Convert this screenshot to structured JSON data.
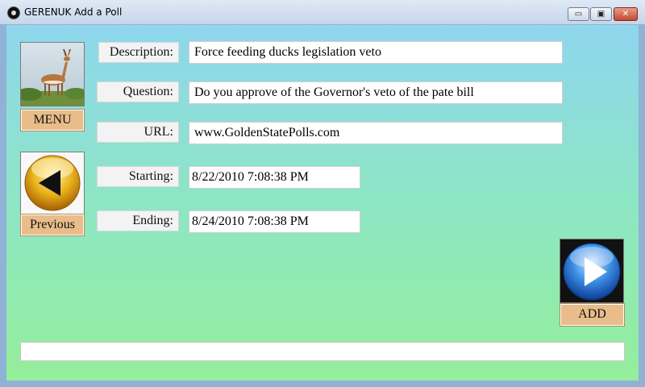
{
  "window": {
    "title": "GERENUK Add a Poll",
    "minimize_glyph": "▭",
    "maximize_glyph": "▣",
    "close_glyph": "✕"
  },
  "sidebar": {
    "menu_label": "MENU",
    "previous_label": "Previous",
    "menu_image": "gerenuk-photo",
    "previous_icon": "back-arrow-orb-icon"
  },
  "form": {
    "description_label": "Description:",
    "description_value": "Force feeding ducks legislation veto",
    "question_label": "Question:",
    "question_value": "Do you approve of the Governor's veto of the pate bill",
    "url_label": "URL:",
    "url_value": "www.GoldenStatePolls.com",
    "starting_label": "Starting:",
    "starting_value": "8/22/2010 7:08:38 PM",
    "ending_label": "Ending:",
    "ending_value": "8/24/2010 7:08:38 PM"
  },
  "actions": {
    "add_label": "ADD",
    "add_icon": "play-orb-icon"
  },
  "status": {
    "text": ""
  },
  "colors": {
    "button_tan": "#e8bd8a",
    "gradient_top": "#8fd6ee",
    "gradient_bottom": "#95ee9b",
    "orb_gold": "#e9b21a",
    "orb_blue": "#1f6fd6"
  }
}
